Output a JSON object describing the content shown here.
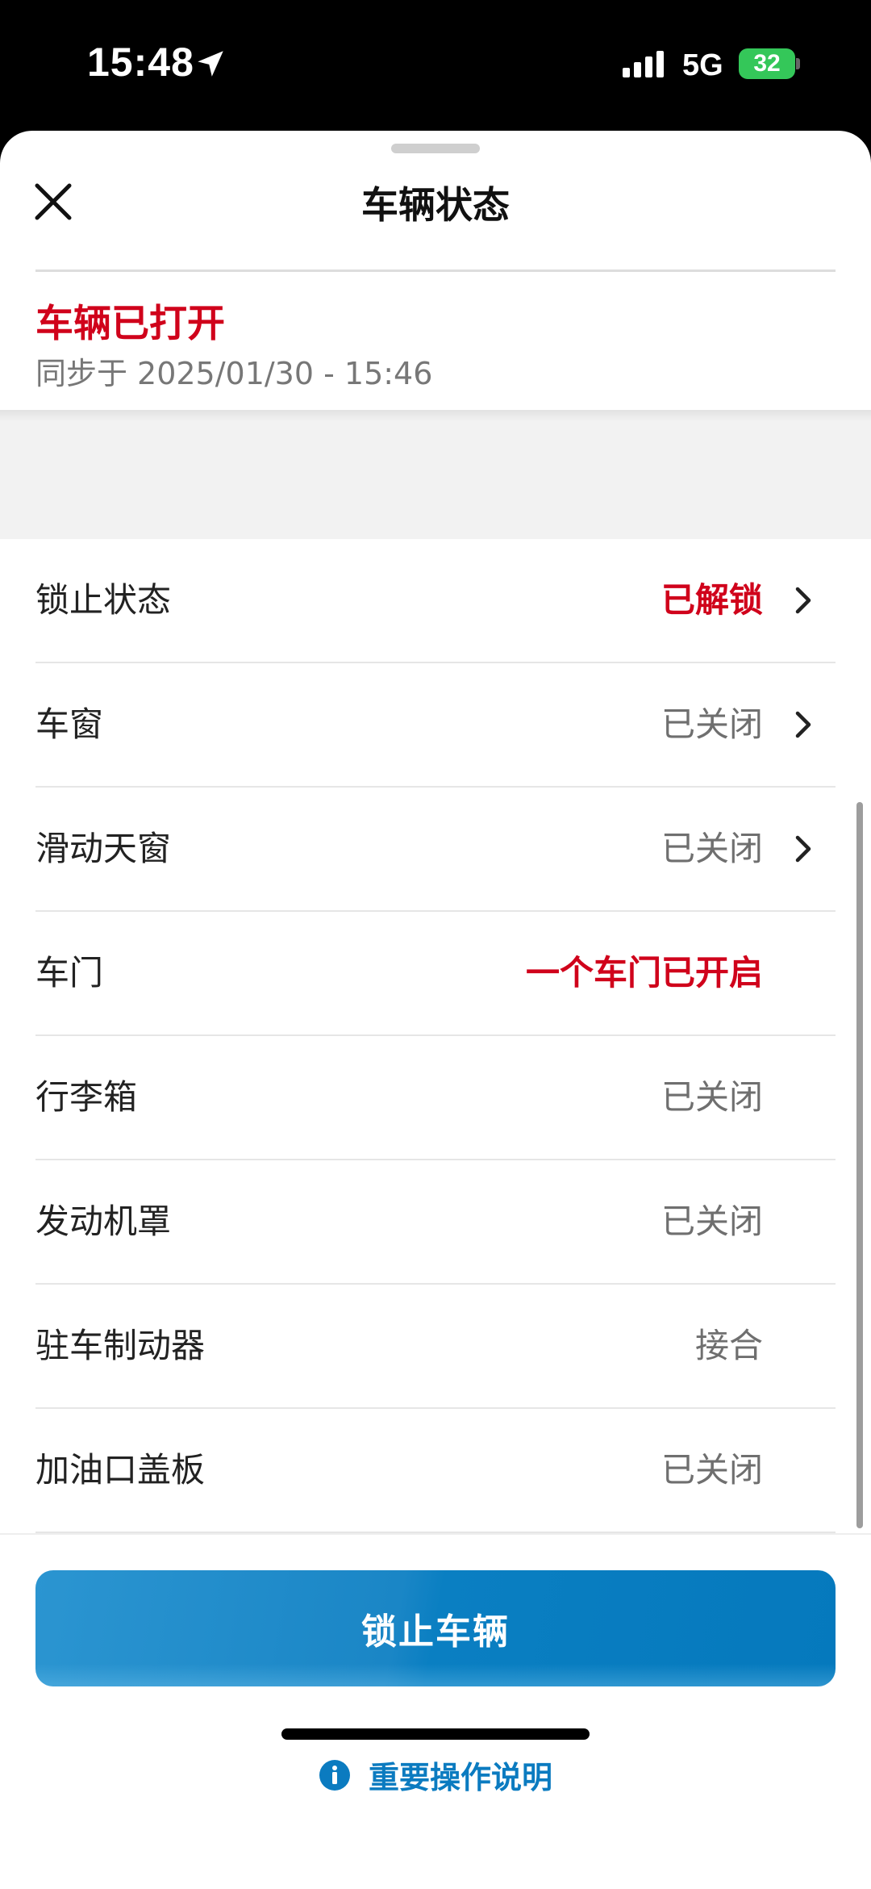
{
  "status_bar": {
    "time": "15:48",
    "network": "5G",
    "battery": "32"
  },
  "sheet": {
    "title": "车辆状态",
    "summary": {
      "status": "车辆已打开",
      "sync_label": "同步于",
      "sync_time": "2025/01/30 - 15:46"
    },
    "rows": [
      {
        "label": "锁止状态",
        "value": "已解锁",
        "alert": true,
        "chevron": true
      },
      {
        "label": "车窗",
        "value": "已关闭",
        "alert": false,
        "chevron": true
      },
      {
        "label": "滑动天窗",
        "value": "已关闭",
        "alert": false,
        "chevron": true
      },
      {
        "label": "车门",
        "value": "一个车门已开启",
        "alert": true,
        "chevron": false
      },
      {
        "label": "行李箱",
        "value": "已关闭",
        "alert": false,
        "chevron": false
      },
      {
        "label": "发动机罩",
        "value": "已关闭",
        "alert": false,
        "chevron": false
      },
      {
        "label": "驻车制动器",
        "value": "接合",
        "alert": false,
        "chevron": false
      },
      {
        "label": "加油口盖板",
        "value": "已关闭",
        "alert": false,
        "chevron": false
      }
    ],
    "lock_button_label": "锁止车辆",
    "info_link_label": "重要操作说明"
  },
  "colors": {
    "alert": "#d0021b",
    "accent": "#0b7bc0",
    "button": "#0a7fc2"
  },
  "icons": [
    "location-arrow-icon",
    "signal-icon",
    "battery-icon",
    "close-icon",
    "chevron-right-icon",
    "info-icon"
  ]
}
